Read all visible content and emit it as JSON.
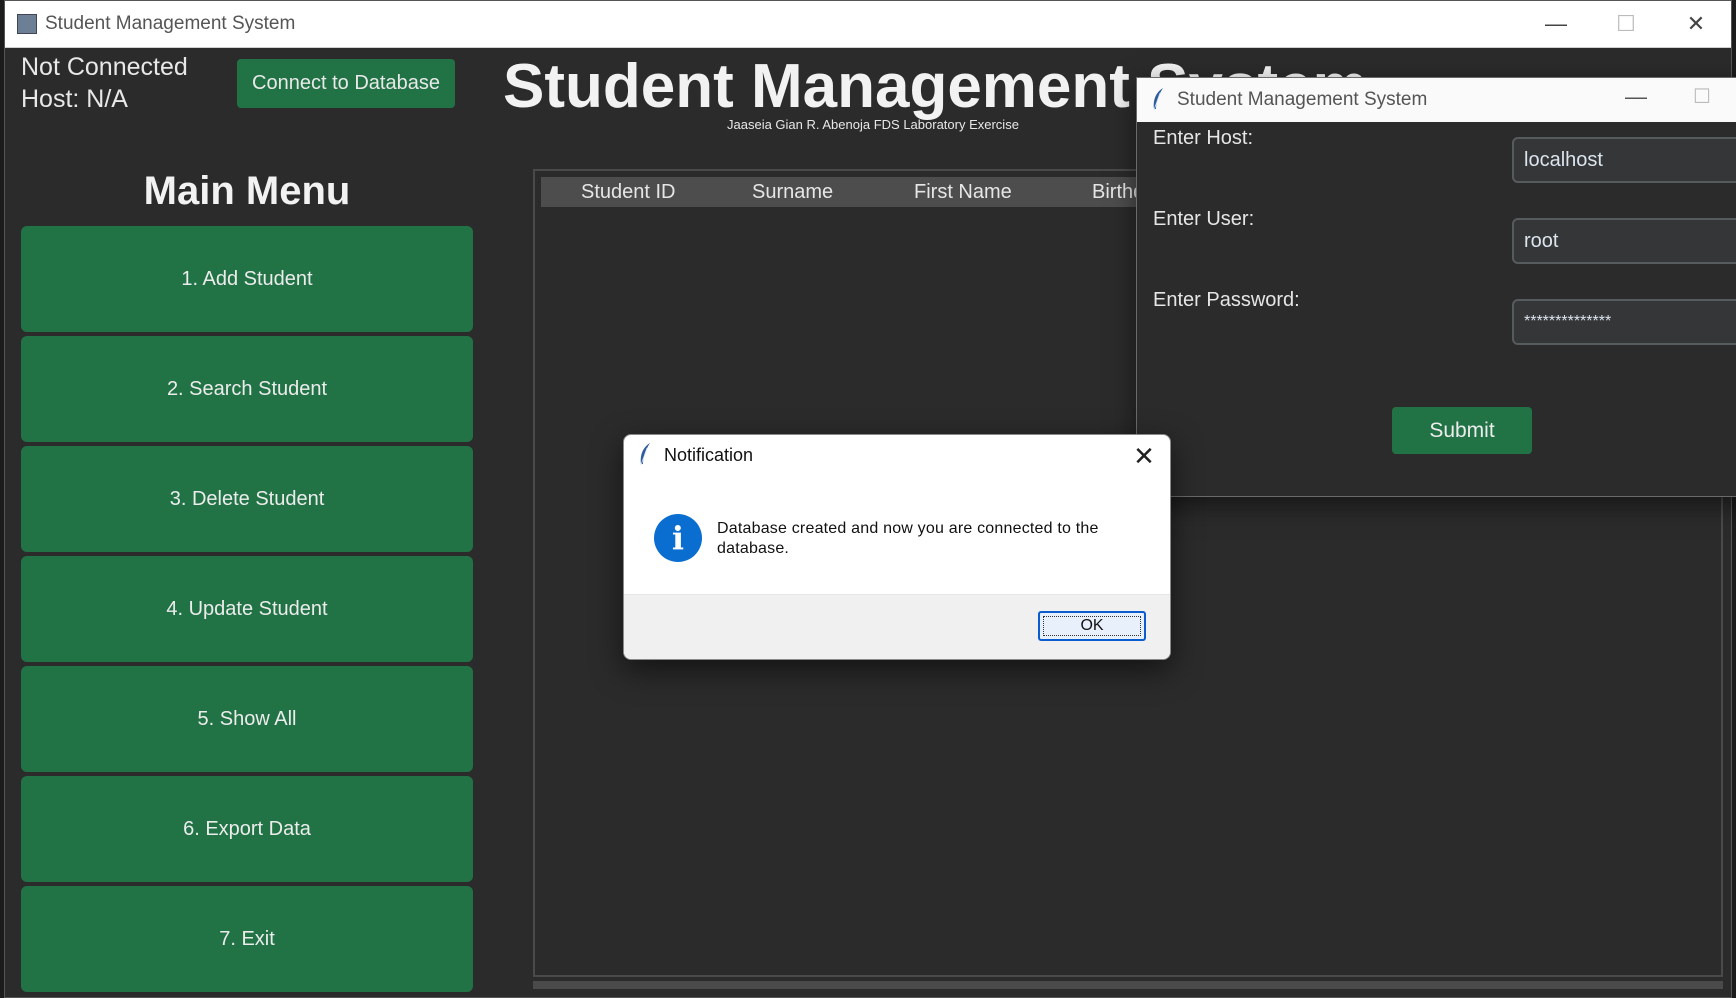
{
  "main_window": {
    "title": "Student Management System",
    "controls": {
      "minimize": "—",
      "maximize": "☐",
      "close": "✕"
    }
  },
  "status": {
    "connection": "Not Connected",
    "host": "Host: N/A"
  },
  "connect_button": "Connect to Database",
  "heading": "Student Management System",
  "subtitle": "Jaaseia Gian R. Abenoja FDS Laboratory Exercise",
  "main_menu": {
    "title": "Main Menu",
    "items": [
      "1. Add Student",
      "2. Search Student",
      "3. Delete Student",
      "4. Update Student",
      "5. Show All",
      "6. Export Data",
      "7. Exit"
    ]
  },
  "table": {
    "columns": [
      "Student ID",
      "Surname",
      "First Name",
      "Birthdate"
    ]
  },
  "db_dialog": {
    "title": "Student Management System",
    "host_label": "Enter Host:",
    "host_value": "localhost",
    "user_label": "Enter User:",
    "user_value": "root",
    "password_label": "Enter Password:",
    "password_value": "**************",
    "submit": "Submit",
    "controls": {
      "minimize": "—",
      "maximize": "☐"
    }
  },
  "notification": {
    "title": "Notification",
    "message": "Database created and now you are connected to the database.",
    "ok": "OK",
    "icon_glyph": "i",
    "close_glyph": "✕"
  },
  "colors": {
    "accent_green": "#217346",
    "window_bg": "#2b2b2b",
    "info_blue": "#0a6ed1"
  }
}
